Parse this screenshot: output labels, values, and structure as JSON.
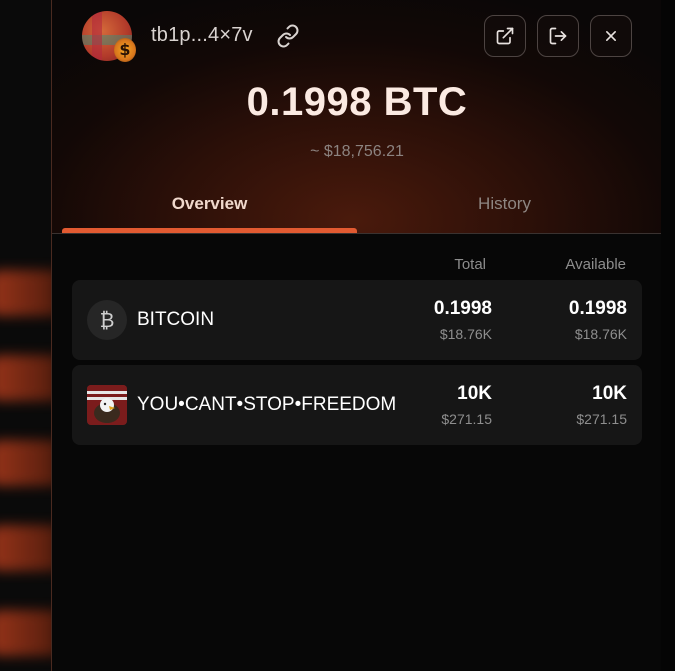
{
  "wallet": {
    "address": "tb1p...4×7v",
    "balance": "0.1998 BTC",
    "balance_usd": "~ $18,756.21"
  },
  "header": {
    "icons": [
      "copy-link-icon",
      "external-link-icon",
      "logout-icon",
      "close-icon"
    ]
  },
  "tabs": [
    {
      "label": "Overview",
      "active": true
    },
    {
      "label": "History",
      "active": false
    }
  ],
  "table": {
    "columns": [
      "Total",
      "Available"
    ],
    "rows": [
      {
        "icon": "bitcoin-icon",
        "name": "BITCOIN",
        "total": "0.1998",
        "total_usd": "$18.76K",
        "available": "0.1998",
        "available_usd": "$18.76K"
      },
      {
        "icon": "rune-thumbnail",
        "name": "YOU•CANT•STOP•FREEDOM",
        "total": "10K",
        "total_usd": "$271.15",
        "available": "10K",
        "available_usd": "$271.15"
      }
    ]
  },
  "colors": {
    "accent": "#e25a31",
    "background": "#070707",
    "row_background": "#161616"
  }
}
